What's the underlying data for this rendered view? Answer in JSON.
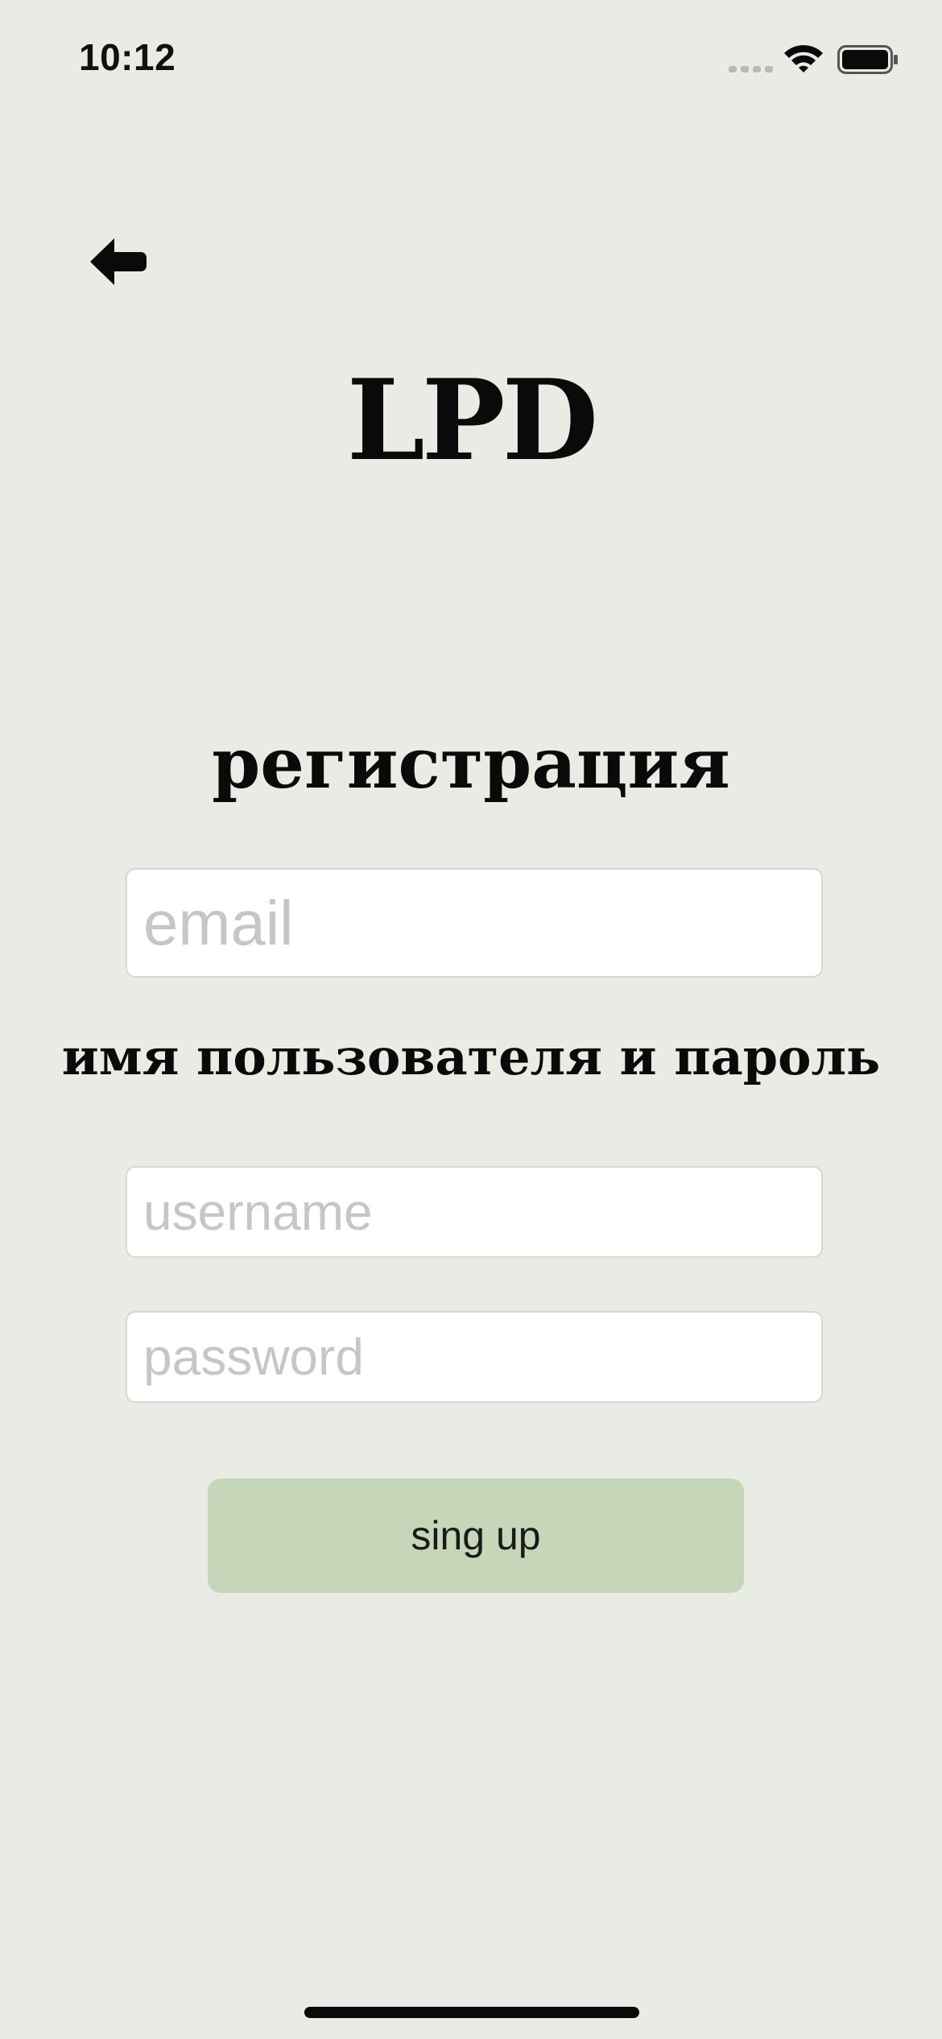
{
  "status_bar": {
    "time": "10:12",
    "icons": [
      "cellular-signal-icon",
      "wifi-icon",
      "battery-icon"
    ]
  },
  "navigation": {
    "back_icon": "arrow-left-icon"
  },
  "app": {
    "logo_text": "LPD"
  },
  "form": {
    "title": "регистрация",
    "email_placeholder": "email",
    "credentials_title": "имя пользователя и пароль",
    "username_placeholder": "username",
    "password_placeholder": "password",
    "submit_label": "sing up"
  },
  "colors": {
    "background": "#e9ebe5",
    "button": "#c5d6b9",
    "field_background": "#ffffff",
    "placeholder": "#c6c6c6",
    "text": "#0a0a0a"
  }
}
